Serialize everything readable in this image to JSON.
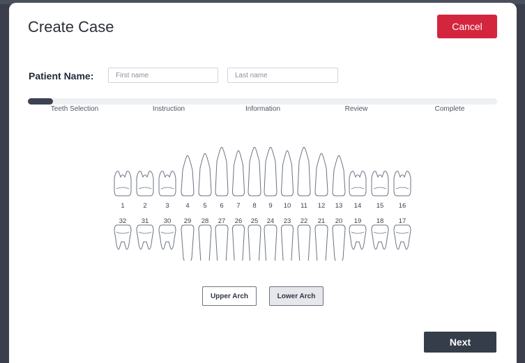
{
  "modal": {
    "title": "Create Case",
    "cancel_label": "Cancel",
    "next_label": "Next"
  },
  "patient": {
    "label": "Patient Name:",
    "first_name_placeholder": "First name",
    "last_name_placeholder": "Last name"
  },
  "progress": {
    "current_step": 1,
    "total_steps": 5,
    "steps": [
      "Teeth Selection",
      "Instruction",
      "Information",
      "Review",
      "Complete"
    ]
  },
  "teeth": {
    "upper": [
      "1",
      "2",
      "3",
      "4",
      "5",
      "6",
      "7",
      "8",
      "9",
      "10",
      "11",
      "12",
      "13",
      "14",
      "15",
      "16"
    ],
    "lower": [
      "32",
      "31",
      "30",
      "29",
      "28",
      "27",
      "26",
      "25",
      "24",
      "23",
      "22",
      "21",
      "20",
      "19",
      "18",
      "17"
    ]
  },
  "arch_buttons": {
    "upper_label": "Upper Arch",
    "lower_label": "Lower Arch"
  },
  "colors": {
    "cancel": "#d4253f",
    "primary_dark": "#353c4a",
    "progress_fill": "#3b4251"
  }
}
